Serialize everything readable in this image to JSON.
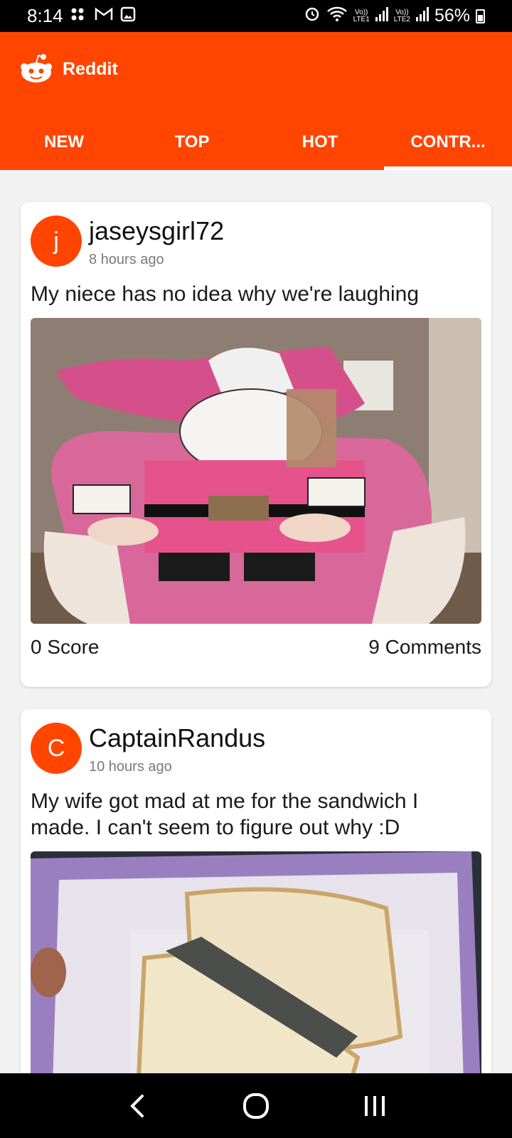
{
  "status_bar": {
    "time": "8:14",
    "lte1": "LTE1",
    "lte2": "LTE2",
    "volte1": "Vo))",
    "volte2": "Vo))",
    "battery": "56%"
  },
  "app": {
    "title": "Reddit",
    "brand_color": "#ff4500"
  },
  "tabs": [
    {
      "label": "NEW",
      "active": false
    },
    {
      "label": "TOP",
      "active": false
    },
    {
      "label": "HOT",
      "active": false
    },
    {
      "label": "CONTR...",
      "active": true
    }
  ],
  "posts": [
    {
      "avatar_letter": "j",
      "username": "jaseysgirl72",
      "time_ago": "8 hours ago",
      "title": "My niece has no idea why we're laughing",
      "score": "0 Score",
      "comments": "9 Comments"
    },
    {
      "avatar_letter": "C",
      "username": "CaptainRandus",
      "time_ago": "10 hours ago",
      "title": "My wife got mad at me for the sandwich I made. I can't seem to figure out why :D"
    }
  ],
  "nav": {
    "icons": [
      "back-icon",
      "home-icon",
      "recents-icon"
    ]
  }
}
